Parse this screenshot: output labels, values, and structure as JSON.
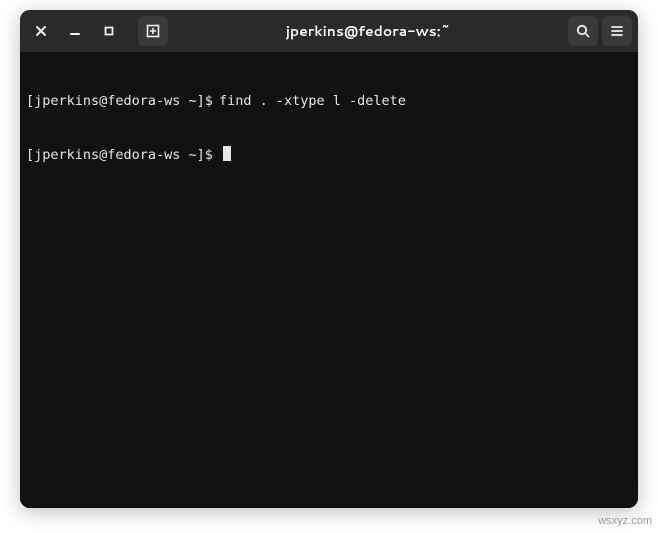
{
  "titlebar": {
    "title": "jperkins@fedora-ws:~"
  },
  "terminal": {
    "lines": [
      {
        "prompt": "[jperkins@fedora-ws ~]$",
        "command": "find . -xtype l -delete"
      },
      {
        "prompt": "[jperkins@fedora-ws ~]$",
        "command": ""
      }
    ]
  },
  "watermark": "wsxyz.com"
}
